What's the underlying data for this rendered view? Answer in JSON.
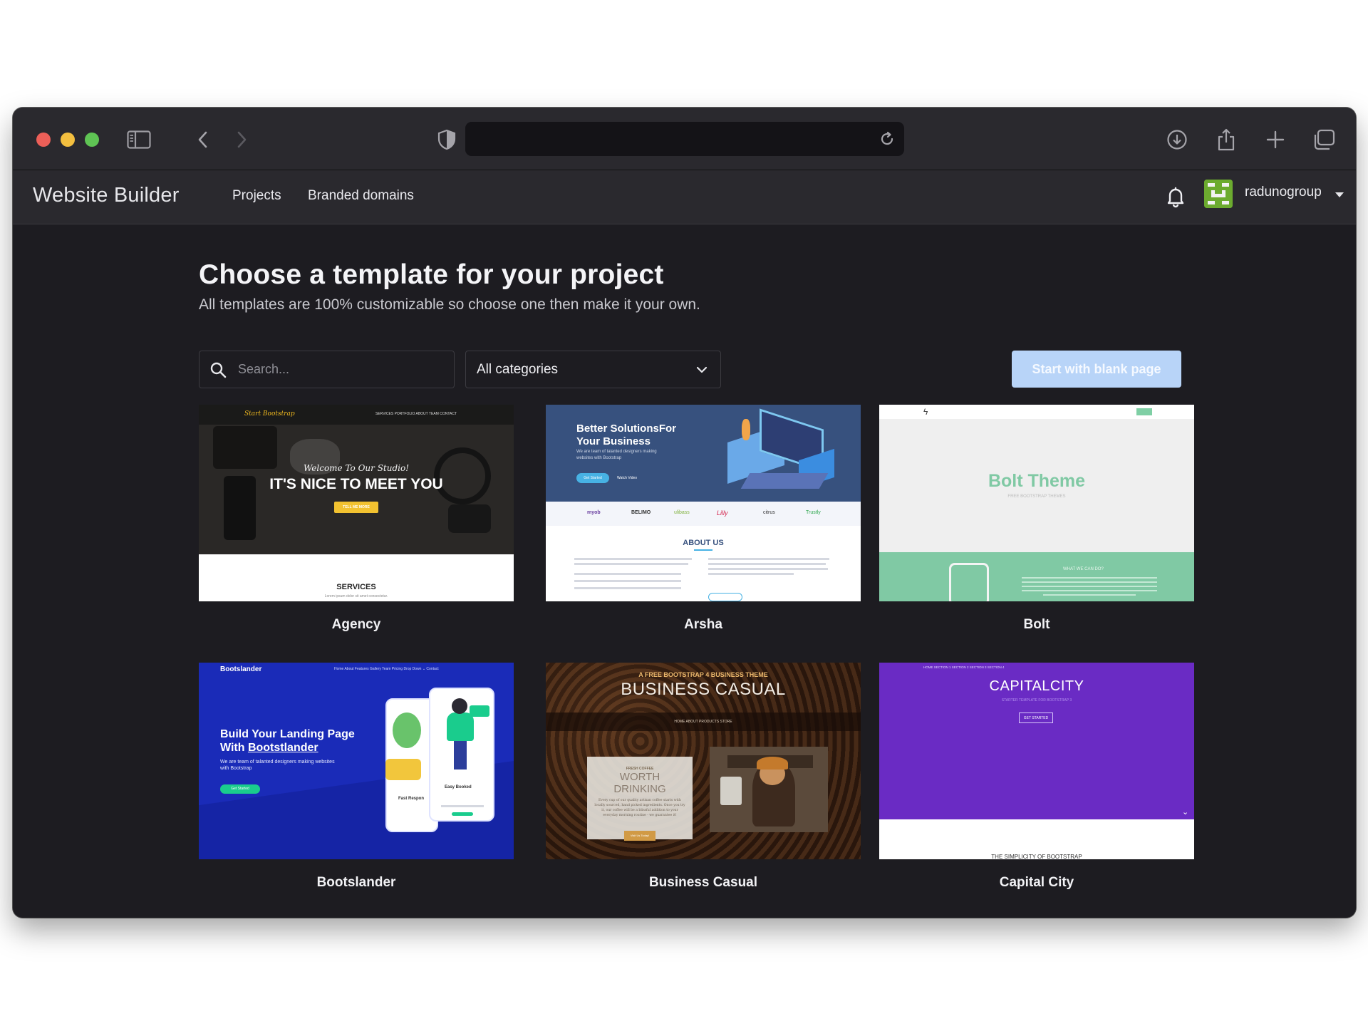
{
  "browser": {
    "url_text": ""
  },
  "appbar": {
    "brand": "Website Builder",
    "nav": [
      {
        "label": "Projects"
      },
      {
        "label": "Branded domains"
      }
    ],
    "username": "radunogroup"
  },
  "page": {
    "title": "Choose a template for your project",
    "subtitle": "All templates are 100% customizable so choose one then make it your own.",
    "search_placeholder": "Search...",
    "category_selected": "All categories",
    "blank_button": "Start with blank page"
  },
  "templates": [
    {
      "name": "Agency",
      "preview": {
        "logo": "Start Bootstrap",
        "menu": "SERVICES    PORTFOLIO    ABOUT    TEAM    CONTACT",
        "kicker": "Welcome To Our Studio!",
        "headline": "IT'S NICE TO MEET YOU",
        "button": "TELL ME MORE",
        "section": "SERVICES",
        "section_sub": "Lorem ipsum dolor sit amet consectetur."
      }
    },
    {
      "name": "Arsha",
      "preview": {
        "headline1": "Better SolutionsFor",
        "headline2": "Your Business",
        "tagline1": "We are team of talanted designers making",
        "tagline2": "websites with Bootstrap",
        "button": "Get Started",
        "video": "Watch Video",
        "logos": [
          "myob",
          "BELIMO",
          "ulibass",
          "Lilly",
          "citrus",
          "Trustly"
        ],
        "section": "ABOUT US"
      }
    },
    {
      "name": "Bolt",
      "preview": {
        "headline": "Bolt Theme",
        "tagline": "FREE BOOTSTRAP THEMES",
        "section": "WHAT WE CAN DO?"
      }
    },
    {
      "name": "Bootslander",
      "preview": {
        "logo": "Bootslander",
        "menu": "Home   About   Features   Gallery   Team   Pricing   Drop Down ⌄   Contact",
        "headline1": "Build Your Landing Page",
        "headline2_prefix": "With ",
        "headline2_brand": "Bootstlander",
        "tagline1": "We are team of talanted designers making websites",
        "tagline2": "with Bootstrap",
        "button": "Get Started",
        "phone1": "Fast Respon",
        "phone2": "Easy Booked"
      }
    },
    {
      "name": "Business Casual",
      "preview": {
        "kicker": "A FREE BOOTSTRAP 4 BUSINESS THEME",
        "headline": "BUSINESS CASUAL",
        "menu": "HOME     ABOUT     PRODUCTS     STORE",
        "box_kicker": "FRESH COFFEE",
        "box_title1": "WORTH",
        "box_title2": "DRINKING",
        "box_text": "Every cup of our quality artisan coffee starts with locally sourced, hand picked ingredients. Once you try it, our coffee will be a blissful addition to your everyday morning routine - we guarantee it!",
        "box_button": "Visit Us Today!"
      }
    },
    {
      "name": "Capital City",
      "preview": {
        "menu": "HOME    SECTION 1    SECTION 2    SECTION 3    SECTION 4",
        "headline": "CAPITALCITY",
        "tagline": "STARTER TEMPLATE FOR BOOTSTRAP 3",
        "button": "GET STARTED",
        "section": "THE SIMPLICITY OF BOOTSTRAP"
      }
    }
  ]
}
